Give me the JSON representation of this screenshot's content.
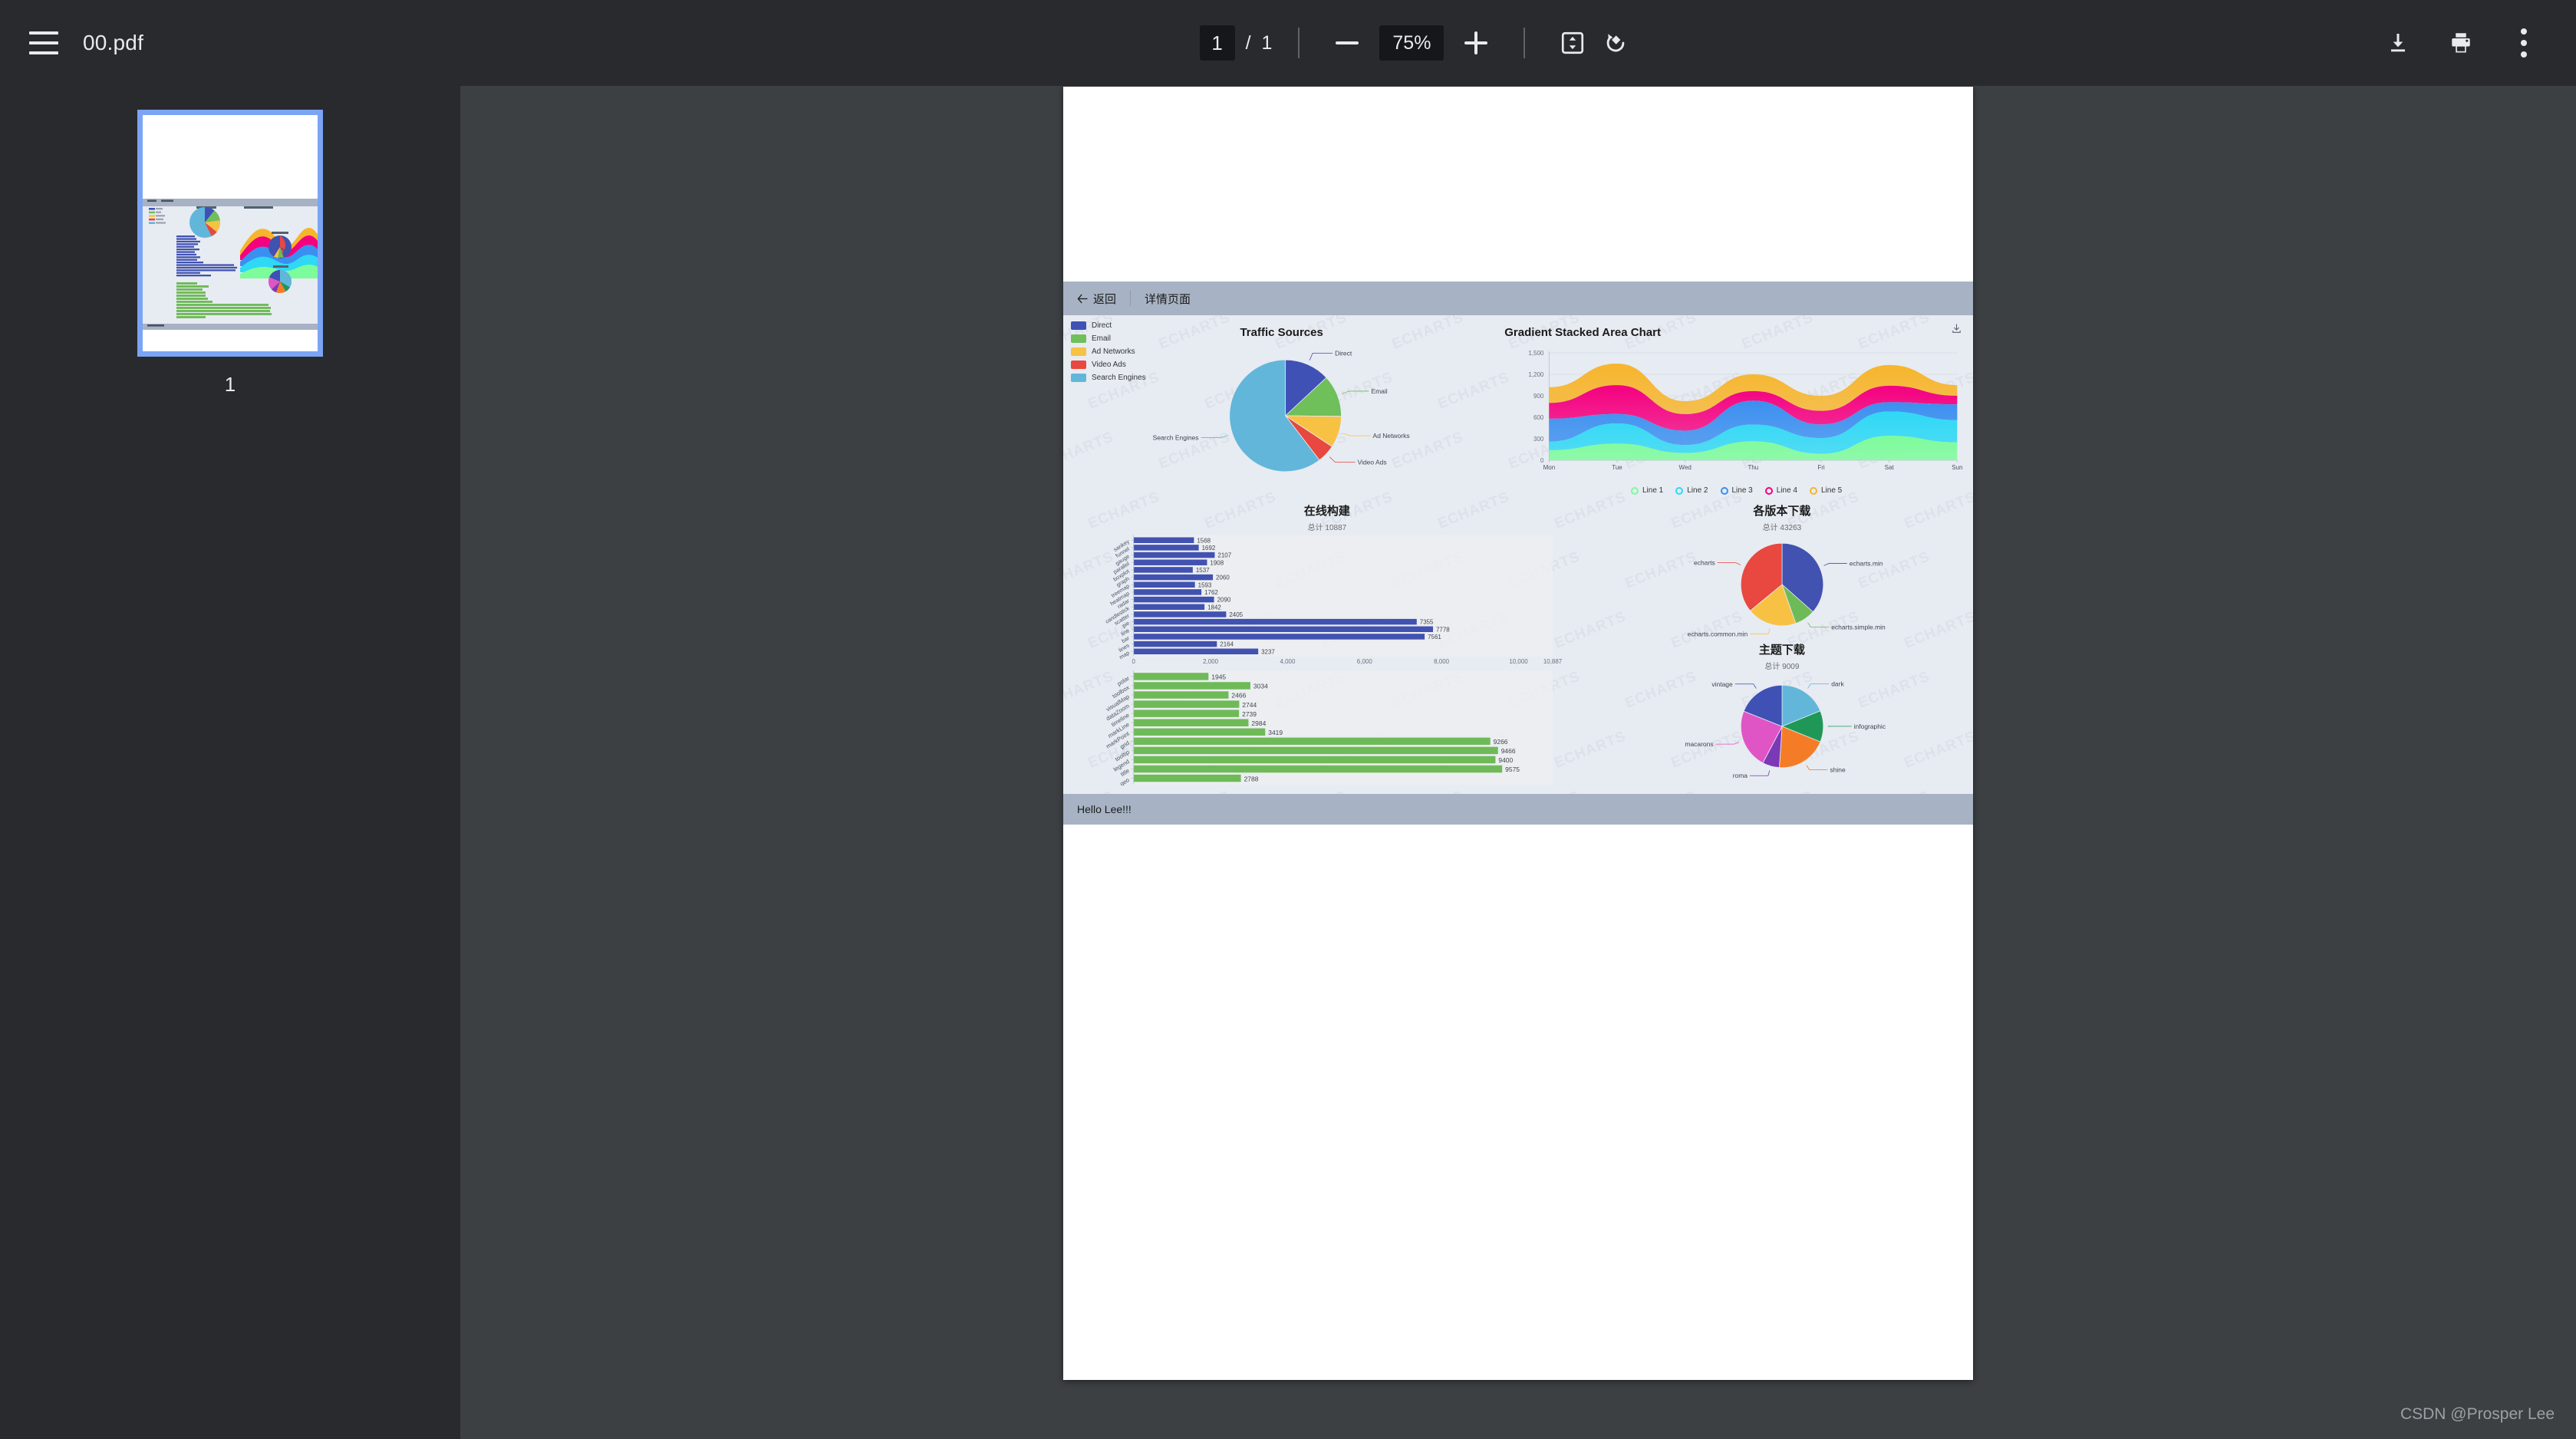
{
  "toolbar": {
    "menu_icon": "hamburger-menu-icon",
    "title": "00.pdf",
    "page_current": "1",
    "page_separator": "/",
    "page_total": "1",
    "zoom_out_icon": "minus-icon",
    "zoom_level": "75%",
    "zoom_in_icon": "plus-icon",
    "fit_icon": "fit-to-page-icon",
    "rotate_icon": "rotate-icon",
    "download_icon": "download-icon",
    "print_icon": "print-icon",
    "more_icon": "kebab-menu-icon"
  },
  "sidebar": {
    "thumbnails": [
      {
        "label": "1",
        "selected": true
      }
    ]
  },
  "document": {
    "navbar": {
      "back_arrow": "arrow-left-icon",
      "back_label": "返回",
      "page_title": "详情页面"
    },
    "footer_text": "Hello Lee!!!",
    "watermark_text": "ECHARTS",
    "save_icon": "download-icon"
  },
  "chart_data": [
    {
      "type": "pie",
      "title": "Traffic Sources",
      "legend_position": "top-left",
      "legend": [
        "Direct",
        "Email",
        "Ad Networks",
        "Video Ads",
        "Search Engines"
      ],
      "categories": [
        "Direct",
        "Email",
        "Ad Networks",
        "Video Ads",
        "Search Engines"
      ],
      "values": [
        335,
        310,
        234,
        135,
        1548
      ],
      "colors": [
        "#3f51b5",
        "#6fbf5b",
        "#f7c244",
        "#e8483f",
        "#62b6da"
      ],
      "labels": [
        "Direct",
        "Email",
        "Ad Networks",
        "Video Ads",
        "Search Engines"
      ]
    },
    {
      "type": "area",
      "title": "Gradient Stacked Area Chart",
      "xlabel": "",
      "ylabel": "",
      "ylim": [
        0,
        1500
      ],
      "yticks": [
        "0",
        "300",
        "600",
        "900",
        "1,200",
        "1,500"
      ],
      "grid": true,
      "legend_position": "bottom",
      "x": [
        "Mon",
        "Tue",
        "Wed",
        "Thu",
        "Fri",
        "Sat",
        "Sun"
      ],
      "series": [
        {
          "name": "Line 1",
          "color": "#7cfc9a",
          "values": [
            140,
            232,
            101,
            264,
            90,
            340,
            250
          ]
        },
        {
          "name": "Line 2",
          "color": "#2fd8f5",
          "values": [
            120,
            282,
            111,
            234,
            220,
            340,
            310
          ]
        },
        {
          "name": "Line 3",
          "color": "#3b8ff0",
          "values": [
            320,
            132,
            201,
            334,
            190,
            130,
            220
          ]
        },
        {
          "name": "Line 4",
          "color": "#f5007f",
          "values": [
            220,
            402,
            231,
            134,
            190,
            230,
            120
          ]
        },
        {
          "name": "Line 5",
          "color": "#f7b52c",
          "values": [
            220,
            302,
            181,
            234,
            210,
            290,
            150
          ]
        }
      ]
    },
    {
      "type": "bar",
      "orientation": "horizontal",
      "title": "在线构建",
      "subtitle": "总计 10887",
      "xlim": [
        0,
        10887
      ],
      "xticks": [
        "0",
        "2,000",
        "4,000",
        "6,000",
        "8,000",
        "10,000",
        "10,887"
      ],
      "series_color_blue": "#4152b0",
      "series_color_green": "#6fba58",
      "group_blue": {
        "categories": [
          "sankey",
          "funnel",
          "gauge",
          "parallel",
          "boxplot",
          "graph",
          "treemap",
          "heatmap",
          "radar",
          "candlestick",
          "scatter",
          "pie",
          "line",
          "bar",
          "lines",
          "map"
        ],
        "values": [
          1568,
          1692,
          2107,
          1908,
          1537,
          2060,
          1593,
          1762,
          2090,
          1842,
          2405,
          7355,
          7778,
          7561,
          2164,
          3237
        ]
      },
      "group_green": {
        "categories": [
          "polar",
          "toolbox",
          "visualMap",
          "dataZoom",
          "timeline",
          "markLine",
          "markPoint",
          "grid",
          "tooltip",
          "legend",
          "title",
          "geo"
        ],
        "values": [
          1945,
          3034,
          2466,
          2744,
          2739,
          2984,
          3419,
          9266,
          9466,
          9400,
          9575,
          2788
        ]
      }
    },
    {
      "type": "pie",
      "title": "各版本下载",
      "subtitle": "总计 43263",
      "categories": [
        "echarts.min",
        "echarts.simple.min",
        "echarts.common.min",
        "echarts"
      ],
      "values": [
        15800,
        3500,
        8400,
        15563
      ],
      "colors": [
        "#4152b0",
        "#6fba58",
        "#f7c244",
        "#e8483f"
      ],
      "labels": [
        "echarts.min",
        "echarts.simple.min",
        "echarts.common.min",
        "echarts"
      ]
    },
    {
      "type": "pie",
      "title": "主题下载",
      "subtitle": "总计 9009",
      "categories": [
        "dark",
        "infographic",
        "shine",
        "roma",
        "macarons",
        "vintage"
      ],
      "values": [
        1700,
        1100,
        1800,
        600,
        2100,
        1709
      ],
      "colors": [
        "#62b6da",
        "#1f9757",
        "#f57c27",
        "#7a39b5",
        "#e055c6",
        "#3f51b5"
      ],
      "labels": [
        "dark",
        "infographic",
        "shine",
        "roma",
        "macarons",
        "vintage"
      ]
    }
  ],
  "page_watermark": "CSDN @Prosper Lee"
}
